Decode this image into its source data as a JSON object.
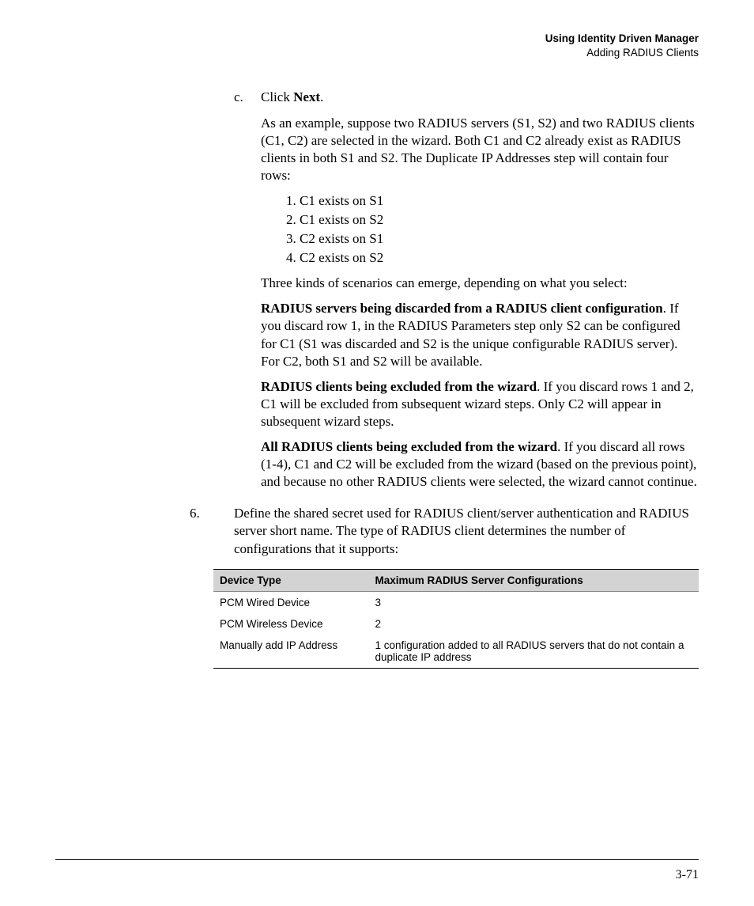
{
  "header": {
    "title": "Using Identity Driven Manager",
    "subtitle": "Adding RADIUS Clients"
  },
  "sub_c": {
    "marker": "c.",
    "lead_pre": "Click ",
    "lead_bold": "Next",
    "lead_post": ".",
    "example": "As an example, suppose two RADIUS servers (S1, S2) and two RADIUS clients (C1, C2) are selected in the wizard. Both C1 and C2 already exist as RADIUS clients in both S1 and S2. The Duplicate IP Addresses step will contain four rows:",
    "rows": [
      "1. C1 exists on S1",
      "2. C1 exists on S2",
      "3. C2 exists on S1",
      "4. C2 exists on S2"
    ],
    "three": "Three kinds of scenarios can emerge, depending on what you select:",
    "scenario1_b": "RADIUS servers being discarded from a RADIUS client configuration",
    "scenario1_t": ". If you discard row 1, in the RADIUS Parameters step only S2 can be configured for C1 (S1 was discarded and S2 is the unique configurable RADIUS server). For C2, both S1 and S2 will be available.",
    "scenario2_b": "RADIUS clients being excluded from the wizard",
    "scenario2_t": ". If you discard rows 1 and 2, C1 will be excluded from subsequent wizard steps. Only C2 will appear in subsequent wizard steps.",
    "scenario3_b": "All RADIUS clients being excluded from the wizard",
    "scenario3_t": ". If you discard all rows (1-4), C1 and C2 will be excluded from the wizard (based on the previous point), and because no other RADIUS clients were selected, the wizard cannot continue."
  },
  "step6": {
    "num": "6.",
    "text": "Define the shared secret used for RADIUS client/server authentication and RADIUS server short name. The type of RADIUS client determines the number of configurations that it supports:"
  },
  "table": {
    "headers": [
      "Device Type",
      "Maximum RADIUS Server Configurations"
    ],
    "rows": [
      [
        "PCM Wired Device",
        "3"
      ],
      [
        "PCM Wireless Device",
        "2"
      ],
      [
        "Manually add IP Address",
        "1 configuration added to all RADIUS servers that do not contain a duplicate IP address"
      ]
    ]
  },
  "page_num": "3-71"
}
